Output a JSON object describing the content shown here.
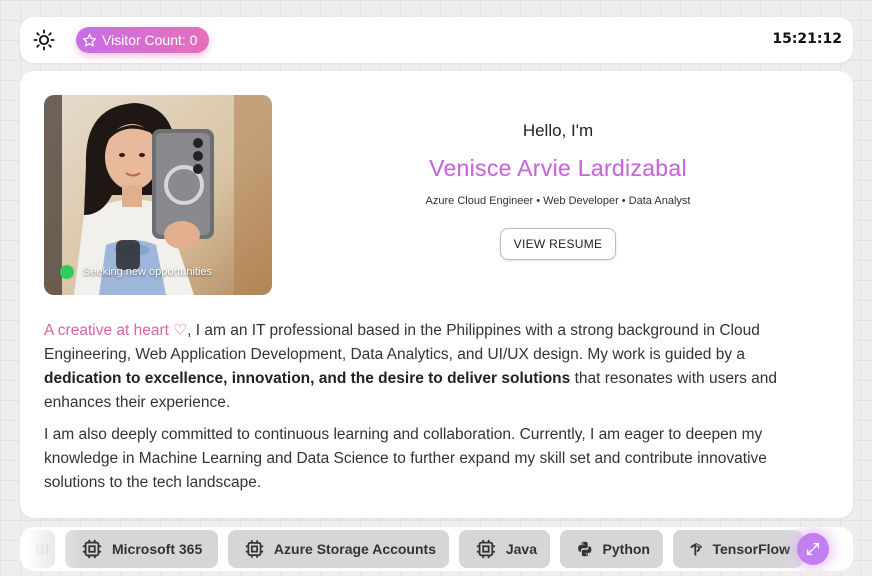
{
  "header": {
    "visitor_label": "Visitor Count: 0",
    "clock": "15:21:12"
  },
  "profile": {
    "status": "Seeking new opportunities",
    "greeting": "Hello, I'm",
    "name": "Venisce Arvie Lardizabal",
    "roles": "Azure Cloud Engineer • Web Developer • Data Analyst",
    "resume_button": "VIEW RESUME"
  },
  "about": {
    "accent": "A creative at heart ♡",
    "p1_a": ", I am an IT professional based in the Philippines with a strong background in Cloud Engineering, Web Application Development, Data Analytics, and UI/UX design. My work is guided by a ",
    "p1_bold": "dedication to excellence, innovation, and the desire to deliver solutions",
    "p1_b": " that resonates with users and enhances their experience.",
    "p2": "I am also deeply committed to continuous learning and collaboration. Currently, I am eager to deepen my knowledge in Machine Learning and Data Science to further expand my skill set and contribute innovative solutions to the tech landscape."
  },
  "skills": {
    "partial": "BI",
    "items": [
      {
        "label": "Microsoft 365",
        "icon": "chip-icon"
      },
      {
        "label": "Azure Storage Accounts",
        "icon": "chip-icon"
      },
      {
        "label": "Java",
        "icon": "chip-icon"
      },
      {
        "label": "Python",
        "icon": "python-icon"
      },
      {
        "label": "TensorFlow",
        "icon": "tensorflow-icon"
      }
    ]
  },
  "colors": {
    "accent_pink": "#d563a6",
    "name_gradient_start": "#b467e3",
    "name_gradient_end": "#d66dc8",
    "status_green": "#2fcc5c",
    "chip_bg": "#d6d6d6"
  }
}
